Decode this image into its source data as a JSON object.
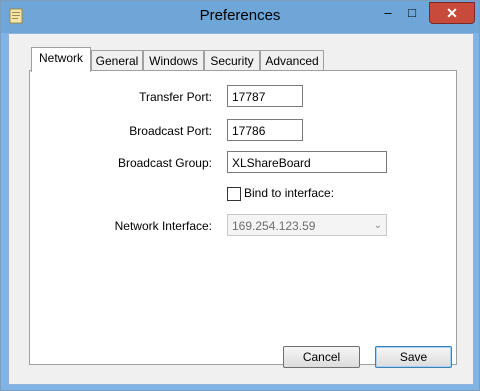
{
  "window": {
    "title": "Preferences"
  },
  "tabs": [
    {
      "label": "Network"
    },
    {
      "label": "General"
    },
    {
      "label": "Windows"
    },
    {
      "label": "Security"
    },
    {
      "label": "Advanced"
    }
  ],
  "network": {
    "transfer_port_label": "Transfer Port:",
    "transfer_port_value": "17787",
    "broadcast_port_label": "Broadcast Port:",
    "broadcast_port_value": "17786",
    "broadcast_group_label": "Broadcast Group:",
    "broadcast_group_value": "XLShareBoard",
    "bind_label": "Bind to interface:",
    "bind_checked": false,
    "interface_label": "Network Interface:",
    "interface_value": "169.254.123.59"
  },
  "buttons": {
    "cancel": "Cancel",
    "save": "Save"
  },
  "colors": {
    "title_bar": "#6fa6d8",
    "close_button": "#c74a3a"
  }
}
